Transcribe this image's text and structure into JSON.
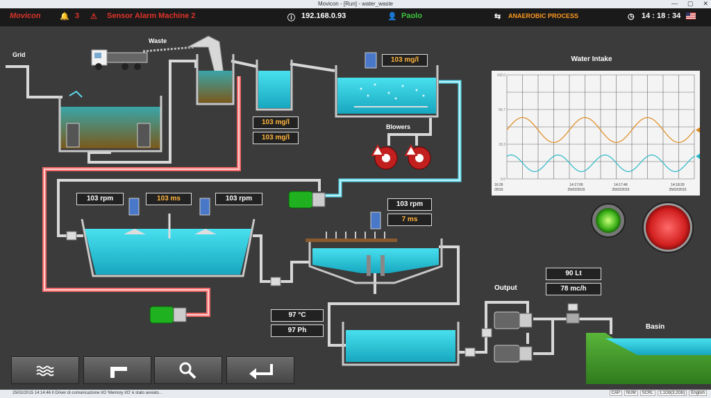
{
  "window": {
    "title": "Movicon - [Run] - water_waste",
    "controls": [
      "—",
      "▢",
      "✕"
    ]
  },
  "header": {
    "brand": "Movicon",
    "alarm_count": "3",
    "alarm_text": "Sensor Alarm Machine 2",
    "ip": "192.168.0.93",
    "user": "Paolo",
    "process": "ANAEROBIC PROCESS",
    "time": "14 : 18 : 34",
    "colors": {
      "brand": "#d9342b",
      "alarm": "#e0332a",
      "user": "#3ec43e",
      "process": "#ff9a1f"
    }
  },
  "labels": {
    "grid": "Grid",
    "waste": "Waste",
    "blowers": "Blowers",
    "output": "Output",
    "basin": "Basin"
  },
  "readings": {
    "tank3_mgl": "103 mg/l",
    "tank2_mgl_a": "103 mg/l",
    "tank2_mgl_b": "103 mg/l",
    "mixer1_rpm": "103 rpm",
    "mixer_ms": "103 ms",
    "mixer2_rpm": "103 rpm",
    "clarifier_rpm": "103 rpm",
    "clarifier_ms": "7 ms",
    "temp": "97 °C",
    "ph": "97 Ph",
    "volume": "90 Lt",
    "flow": "78 mc/h"
  },
  "chart_data": {
    "type": "line",
    "title": "Water Intake",
    "y_ticks": [
      "100.0",
      "66.7",
      "33.3",
      "0.0"
    ],
    "x_ticks": [
      "16:26\n/2015",
      "14:17:06\n25/02/2015",
      "14:17:46\n25/02/2015",
      "14:18:26\n25/02/2015"
    ],
    "ylim": [
      0,
      100
    ],
    "series": [
      {
        "color": "#e08a1e",
        "center": 47,
        "amplitude": 12,
        "cycles": 3
      },
      {
        "color": "#2ab8c8",
        "center": 15,
        "amplitude": 8,
        "cycles": 4
      }
    ],
    "grid": true
  },
  "indicators": {
    "green_on": true,
    "red_alarm": true
  },
  "toolbar": {
    "buttons": [
      "waves-icon",
      "faucet-icon",
      "magnifier-icon",
      "enter-arrow-icon"
    ]
  },
  "statusbar": {
    "message": "25/02/2015 14:14:46 Il Driver di comunicazione I/O  'Memory I/O' è stato avviato...",
    "indicators": [
      "CAP",
      "NUM",
      "SCRL"
    ],
    "memory": "1,1Gb(3,2Gb)",
    "language": "English"
  }
}
